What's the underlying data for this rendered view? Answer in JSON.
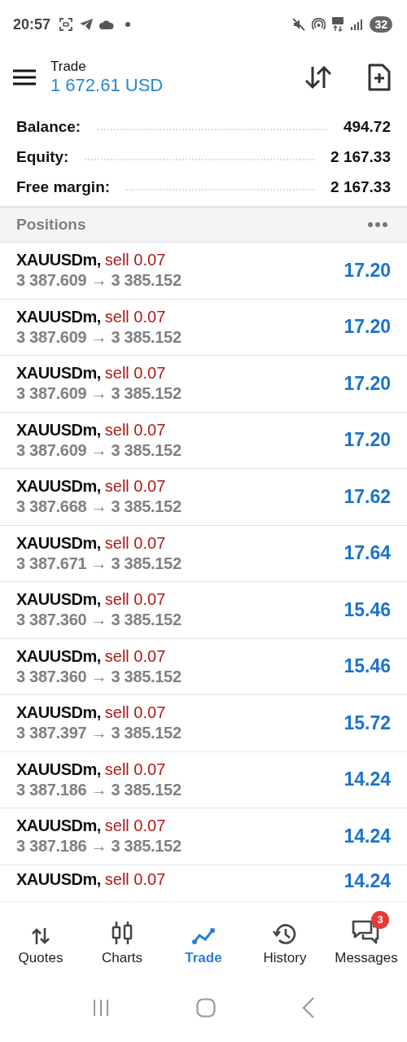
{
  "status_bar": {
    "time": "20:57",
    "battery": "32"
  },
  "header": {
    "title": "Trade",
    "amount": "1 672.61 USD"
  },
  "summary": [
    {
      "label": "Balance:",
      "value": "494.72"
    },
    {
      "label": "Equity:",
      "value": "2 167.33"
    },
    {
      "label": "Free margin:",
      "value": "2 167.33"
    }
  ],
  "positions": {
    "title": "Positions",
    "rows": [
      {
        "symbol": "XAUUSDm,",
        "order": "sell 0.07",
        "prices": "3 387.609 → 3 385.152",
        "profit": "17.20"
      },
      {
        "symbol": "XAUUSDm,",
        "order": "sell 0.07",
        "prices": "3 387.609 → 3 385.152",
        "profit": "17.20"
      },
      {
        "symbol": "XAUUSDm,",
        "order": "sell 0.07",
        "prices": "3 387.609 → 3 385.152",
        "profit": "17.20"
      },
      {
        "symbol": "XAUUSDm,",
        "order": "sell 0.07",
        "prices": "3 387.609 → 3 385.152",
        "profit": "17.20"
      },
      {
        "symbol": "XAUUSDm,",
        "order": "sell 0.07",
        "prices": "3 387.668 → 3 385.152",
        "profit": "17.62"
      },
      {
        "symbol": "XAUUSDm,",
        "order": "sell 0.07",
        "prices": "3 387.671 → 3 385.152",
        "profit": "17.64"
      },
      {
        "symbol": "XAUUSDm,",
        "order": "sell 0.07",
        "prices": "3 387.360 → 3 385.152",
        "profit": "15.46"
      },
      {
        "symbol": "XAUUSDm,",
        "order": "sell 0.07",
        "prices": "3 387.360 → 3 385.152",
        "profit": "15.46"
      },
      {
        "symbol": "XAUUSDm,",
        "order": "sell 0.07",
        "prices": "3 387.397 → 3 385.152",
        "profit": "15.72"
      },
      {
        "symbol": "XAUUSDm,",
        "order": "sell 0.07",
        "prices": "3 387.186 → 3 385.152",
        "profit": "14.24"
      },
      {
        "symbol": "XAUUSDm,",
        "order": "sell 0.07",
        "prices": "3 387.186 → 3 385.152",
        "profit": "14.24"
      },
      {
        "symbol": "XAUUSDm,",
        "order": "sell 0.07",
        "profit": "14.24"
      }
    ]
  },
  "bottom_nav": [
    {
      "label": "Quotes",
      "selected": false
    },
    {
      "label": "Charts",
      "selected": false
    },
    {
      "label": "Trade",
      "selected": true
    },
    {
      "label": "History",
      "selected": false
    },
    {
      "label": "Messages",
      "selected": false,
      "badge": "3"
    }
  ]
}
